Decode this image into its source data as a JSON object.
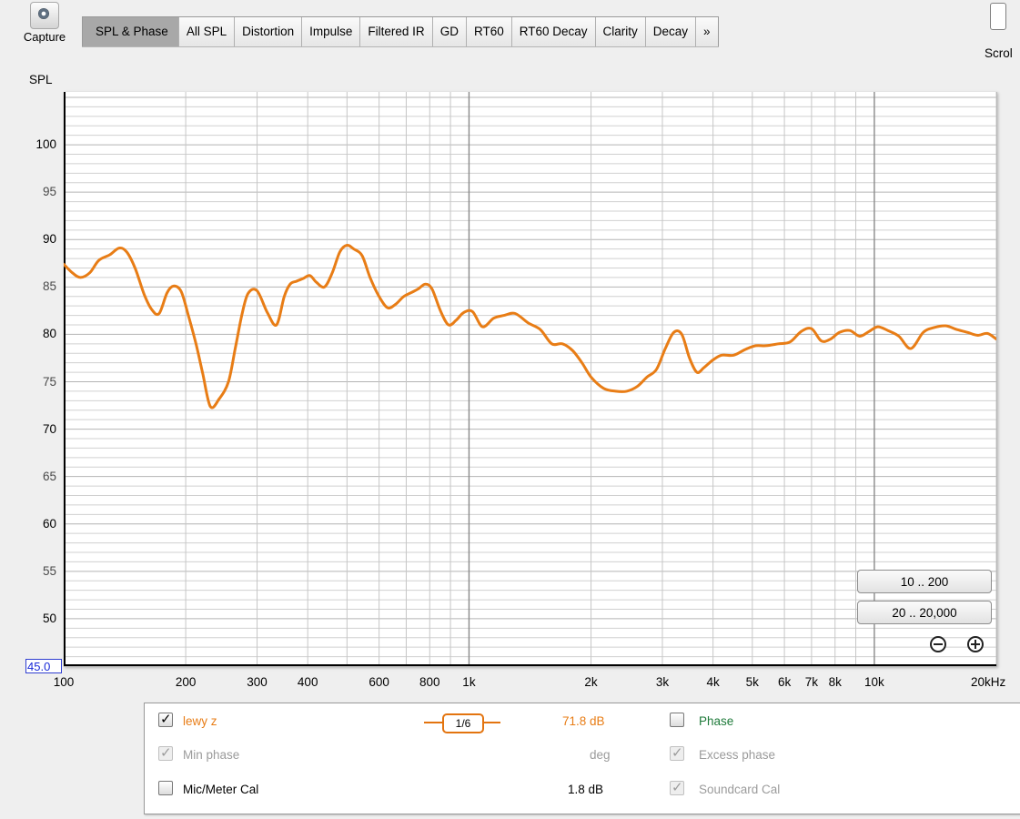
{
  "toolbar": {
    "capture_label": "Capture",
    "scroll_label": "Scrol",
    "tabs": [
      "SPL & Phase",
      "All SPL",
      "Distortion",
      "Impulse",
      "Filtered IR",
      "GD",
      "RT60",
      "RT60 Decay",
      "Clarity",
      "Decay",
      "»"
    ],
    "active_tab": "SPL & Phase"
  },
  "graph": {
    "y_axis_title": "SPL",
    "y_min_value": "45.0",
    "y_tick_labels": [
      "100",
      "95",
      "90",
      "85",
      "80",
      "75",
      "70",
      "65",
      "60",
      "55",
      "50"
    ],
    "x_tick_labels": [
      "100",
      "200",
      "300",
      "400",
      "600",
      "800",
      "1k",
      "2k",
      "3k",
      "4k",
      "5k",
      "6k",
      "7k",
      "8k",
      "10k",
      "20kHz"
    ],
    "zoom_buttons": [
      "10 .. 200",
      "20 .. 20,000"
    ],
    "colors": {
      "trace": "#e87d16",
      "background": "#ffffff",
      "grid": "#d0d0d0",
      "decade_grid": "#8a8a8a"
    }
  },
  "legend": {
    "trace_name": "lewy z",
    "trace_checked": true,
    "smoothing": "1/6",
    "trace_value": "71.8 dB",
    "phase_label": "Phase",
    "phase_checked": false,
    "min_phase_label": "Min phase",
    "min_phase_value": "deg",
    "excess_phase_label": "Excess phase",
    "mic_cal_label": "Mic/Meter Cal",
    "mic_cal_value": "1.8 dB",
    "soundcard_cal_label": "Soundcard Cal"
  },
  "chart_data": {
    "type": "line",
    "title": "",
    "xlabel": "",
    "ylabel": "SPL",
    "x_scale": "log",
    "xlim": [
      100,
      20000
    ],
    "ylim": [
      45,
      105
    ],
    "grid": true,
    "series": [
      {
        "name": "lewy z",
        "x": [
          100,
          105,
          110,
          116,
          122,
          130,
          137,
          143,
          150,
          158,
          165,
          172,
          180,
          187,
          195,
          203,
          212,
          220,
          230,
          242,
          255,
          265,
          275,
          285,
          300,
          318,
          335,
          350,
          362,
          375,
          390,
          405,
          420,
          440,
          460,
          480,
          500,
          520,
          545,
          570,
          600,
          630,
          660,
          690,
          720,
          750,
          780,
          810,
          850,
          890,
          930,
          970,
          1020,
          1080,
          1150,
          1220,
          1300,
          1400,
          1500,
          1600,
          1700,
          1800,
          1900,
          2000,
          2150,
          2300,
          2450,
          2600,
          2750,
          2900,
          3050,
          3200,
          3350,
          3500,
          3650,
          3800,
          4000,
          4200,
          4500,
          4800,
          5100,
          5400,
          5800,
          6200,
          6600,
          7000,
          7400,
          7800,
          8200,
          8700,
          9200,
          9700,
          10200,
          10800,
          11500,
          12300,
          13200,
          14000,
          15000,
          16000,
          17000,
          18000,
          19000,
          20000
        ],
        "y": [
          87.4,
          86.5,
          86.0,
          86.5,
          87.8,
          88.4,
          89.1,
          88.7,
          87.0,
          84.2,
          82.6,
          82.2,
          84.4,
          85.1,
          84.5,
          82.0,
          79.0,
          76.0,
          72.4,
          73.2,
          75.0,
          78.5,
          82.0,
          84.3,
          84.6,
          82.3,
          81.0,
          84.0,
          85.3,
          85.6,
          85.9,
          86.2,
          85.5,
          85.0,
          86.5,
          88.7,
          89.4,
          89.0,
          88.3,
          86.0,
          84.0,
          82.8,
          83.2,
          84.0,
          84.4,
          84.8,
          85.3,
          84.8,
          82.5,
          81.0,
          81.5,
          82.3,
          82.4,
          80.8,
          81.7,
          82.0,
          82.2,
          81.2,
          80.5,
          79.0,
          79.0,
          78.3,
          77.0,
          75.5,
          74.3,
          74.0,
          74.0,
          74.5,
          75.5,
          76.3,
          78.5,
          80.2,
          80.0,
          77.5,
          76.0,
          76.5,
          77.3,
          77.8,
          77.8,
          78.4,
          78.8,
          78.8,
          79.0,
          79.2,
          80.3,
          80.6,
          79.3,
          79.5,
          80.2,
          80.4,
          79.8,
          80.3,
          80.8,
          80.4,
          79.8,
          78.5,
          80.2,
          80.7,
          80.9,
          80.5,
          80.2,
          79.9,
          80.1,
          79.5
        ]
      }
    ]
  }
}
